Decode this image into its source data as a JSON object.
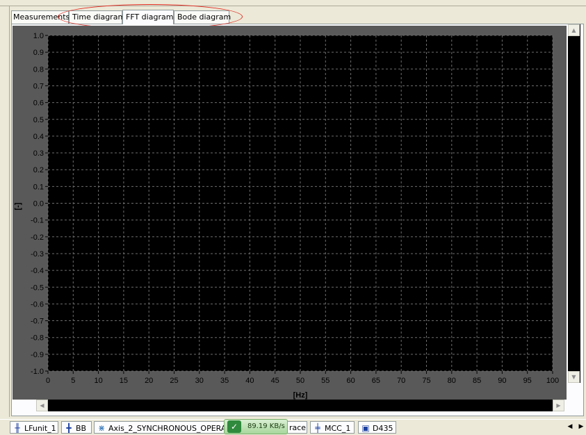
{
  "tabs": [
    {
      "label": "Measurements",
      "active": false
    },
    {
      "label": "Time diagram",
      "active": false
    },
    {
      "label": "FFT diagram",
      "active": true
    },
    {
      "label": "Bode diagram",
      "active": false
    }
  ],
  "chart_data": {
    "type": "line",
    "title": "",
    "xlabel": "[Hz]",
    "ylabel": "[-]",
    "xlim": [
      0,
      100
    ],
    "ylim": [
      -1.0,
      1.0
    ],
    "x_ticks": [
      "0",
      "5",
      "10",
      "15",
      "20",
      "25",
      "30",
      "35",
      "40",
      "45",
      "50",
      "55",
      "60",
      "65",
      "70",
      "75",
      "80",
      "85",
      "90",
      "95",
      "100"
    ],
    "y_ticks": [
      "1.0",
      "0.9",
      "0.8",
      "0.7",
      "0.6",
      "0.5",
      "0.4",
      "0.3",
      "0.2",
      "0.1",
      "0.0",
      "-0.1",
      "-0.2",
      "-0.3",
      "-0.4",
      "-0.5",
      "-0.6",
      "-0.7",
      "-0.8",
      "-0.9",
      "-1.0"
    ],
    "grid": true,
    "series": [],
    "colors": {
      "plot_bg": "#000000",
      "frame_bg": "#595959",
      "grid": "#6e6e6e",
      "tick_text": "#000000"
    }
  },
  "taskbar": {
    "items": [
      {
        "label": "LFunit_1",
        "icon": "drive-unit-icon"
      },
      {
        "label": "BB",
        "icon": "plus-bar-icon"
      },
      {
        "label": "Axis_2_SYNCHRONOUS_OPERA",
        "icon": "axis-icon"
      },
      {
        "label": "race",
        "icon": "trace-icon"
      },
      {
        "label": "MCC_1",
        "icon": "mcc-icon"
      },
      {
        "label": "D435",
        "icon": "device-icon"
      }
    ],
    "speed_overlay": "89.19 KB/s"
  }
}
